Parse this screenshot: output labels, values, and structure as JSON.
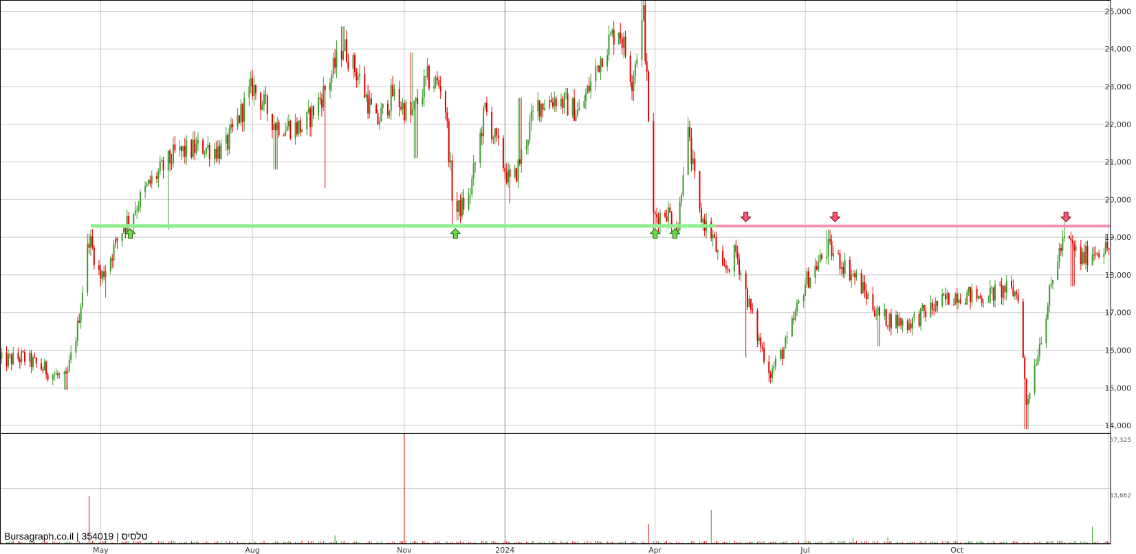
{
  "caption": "Bursagraph.co.il | 354019 | טלסיס",
  "colors": {
    "up": "#3a9a2a",
    "down": "#e00000",
    "support_line": "#90ee90",
    "resistance_line": "#f48fb1",
    "grid": "#c8c8c8",
    "up_marker": "#66dd44",
    "down_marker": "#ff5577"
  },
  "icons": {
    "up_marker": "arrow-up-icon",
    "down_marker": "arrow-down-icon"
  },
  "chart_data": {
    "type": "candlestick",
    "title": "",
    "xlabel": "",
    "ylabel": "",
    "x_range": [
      "2023-03-01",
      "2025-01-02"
    ],
    "ylim": [
      13800,
      25300
    ],
    "y_ticks": [
      14000,
      15000,
      16000,
      17000,
      18000,
      19000,
      20000,
      21000,
      22000,
      23000,
      24000,
      25000
    ],
    "y_tick_labels": [
      "14,000",
      "15,000",
      "16,000",
      "17,000",
      "18,000",
      "19,000",
      "20,000",
      "21,000",
      "22,000",
      "23,000",
      "24,000",
      "25,000"
    ],
    "x_ticks": [
      {
        "date": "2023-05-01",
        "label": "May"
      },
      {
        "date": "2023-08-01",
        "label": "Aug"
      },
      {
        "date": "2023-11-01",
        "label": "Nov"
      },
      {
        "date": "2024-01-01",
        "label": "2024"
      },
      {
        "date": "2024-04-01",
        "label": "Apr"
      },
      {
        "date": "2024-07-01",
        "label": "Jul"
      },
      {
        "date": "2024-10-01",
        "label": "Oct"
      },
      {
        "date": "2025-01-01",
        "label": ""
      }
    ],
    "grid": true,
    "price_path": [
      [
        "2023-03-01",
        15700
      ],
      [
        "2023-03-15",
        15800
      ],
      [
        "2023-04-01",
        15400
      ],
      [
        "2023-04-10",
        15200
      ],
      [
        "2023-04-17",
        16600
      ],
      [
        "2023-04-24",
        19000
      ],
      [
        "2023-05-01",
        17900
      ],
      [
        "2023-05-08",
        18600
      ],
      [
        "2023-05-15",
        19300
      ],
      [
        "2023-05-22",
        19800
      ],
      [
        "2023-06-01",
        20500
      ],
      [
        "2023-06-15",
        21200
      ],
      [
        "2023-07-01",
        21400
      ],
      [
        "2023-07-15",
        21300
      ],
      [
        "2023-08-01",
        23000
      ],
      [
        "2023-08-15",
        22000
      ],
      [
        "2023-09-01",
        21900
      ],
      [
        "2023-09-15",
        23000
      ],
      [
        "2023-09-25",
        24100
      ],
      [
        "2023-10-05",
        23200
      ],
      [
        "2023-10-15",
        22000
      ],
      [
        "2023-10-25",
        22800
      ],
      [
        "2023-11-05",
        22200
      ],
      [
        "2023-11-15",
        23200
      ],
      [
        "2023-11-25",
        23000
      ],
      [
        "2023-12-01",
        19600
      ],
      [
        "2023-12-10",
        20000
      ],
      [
        "2023-12-20",
        22400
      ],
      [
        "2024-01-05",
        20300
      ],
      [
        "2024-01-20",
        22500
      ],
      [
        "2024-02-01",
        22700
      ],
      [
        "2024-02-15",
        22300
      ],
      [
        "2024-03-01",
        24000
      ],
      [
        "2024-03-10",
        24600
      ],
      [
        "2024-03-18",
        23200
      ],
      [
        "2024-03-25",
        24900
      ],
      [
        "2024-03-31",
        19500
      ],
      [
        "2024-04-08",
        19700
      ],
      [
        "2024-04-15",
        19300
      ],
      [
        "2024-04-20",
        22000
      ],
      [
        "2024-04-28",
        19600
      ],
      [
        "2024-05-06",
        19000
      ],
      [
        "2024-05-12",
        18000
      ],
      [
        "2024-05-20",
        18600
      ],
      [
        "2024-06-01",
        16500
      ],
      [
        "2024-06-10",
        15400
      ],
      [
        "2024-06-20",
        16200
      ],
      [
        "2024-07-01",
        17800
      ],
      [
        "2024-07-15",
        18700
      ],
      [
        "2024-08-01",
        17900
      ],
      [
        "2024-08-15",
        16900
      ],
      [
        "2024-09-01",
        16700
      ],
      [
        "2024-09-15",
        17100
      ],
      [
        "2024-10-01",
        17500
      ],
      [
        "2024-10-15",
        17400
      ],
      [
        "2024-10-30",
        17600
      ],
      [
        "2024-11-07",
        17500
      ],
      [
        "2024-11-12",
        14600
      ],
      [
        "2024-11-20",
        16200
      ],
      [
        "2024-12-01",
        18500
      ],
      [
        "2024-12-06",
        19000
      ],
      [
        "2024-12-15",
        18400
      ],
      [
        "2024-12-25",
        18700
      ],
      [
        "2025-01-01",
        18700
      ]
    ],
    "lows": [
      [
        "2023-04-10",
        14950
      ],
      [
        "2023-05-05",
        17400
      ],
      [
        "2023-06-10",
        19200
      ],
      [
        "2023-08-15",
        20800
      ],
      [
        "2023-09-15",
        20300
      ],
      [
        "2023-11-08",
        21100
      ],
      [
        "2023-12-01",
        19350
      ],
      [
        "2024-01-05",
        19900
      ],
      [
        "2024-03-31",
        19000
      ],
      [
        "2024-04-12",
        19100
      ],
      [
        "2024-05-25",
        15800
      ],
      [
        "2024-06-10",
        15150
      ],
      [
        "2024-08-15",
        16100
      ],
      [
        "2024-11-12",
        13900
      ],
      [
        "2024-12-10",
        17700
      ]
    ],
    "highs": [
      [
        "2023-04-24",
        19100
      ],
      [
        "2023-08-01",
        23300
      ],
      [
        "2023-09-25",
        24600
      ],
      [
        "2023-11-05",
        23900
      ],
      [
        "2024-01-10",
        22700
      ],
      [
        "2024-03-25",
        25300
      ],
      [
        "2024-04-20",
        22200
      ],
      [
        "2024-07-15",
        19200
      ],
      [
        "2024-12-06",
        19400
      ]
    ],
    "support": {
      "value": 19300,
      "from": "2023-04-25",
      "to": "2024-05-08"
    },
    "resistance": {
      "value": 19300,
      "from": "2024-05-08",
      "to": "2025-01-02"
    },
    "up_markers": [
      "2023-05-19",
      "2023-12-02",
      "2024-04-01",
      "2024-04-13"
    ],
    "down_markers": [
      "2024-05-26",
      "2024-07-19",
      "2024-12-06"
    ],
    "volume": {
      "ylim": [
        0,
        67325
      ],
      "y_ticks": [
        33662,
        67325
      ],
      "y_tick_labels": [
        "33,662",
        "67,325"
      ],
      "spikes": [
        [
          "2023-04-24",
          29000
        ],
        [
          "2023-09-20",
          5000
        ],
        [
          "2023-11-01",
          67325
        ],
        [
          "2023-12-01",
          9500
        ],
        [
          "2024-03-28",
          12000
        ],
        [
          "2024-05-05",
          20500
        ],
        [
          "2024-07-30",
          3500
        ],
        [
          "2024-08-20",
          4000
        ],
        [
          "2024-11-15",
          11000
        ],
        [
          "2024-12-22",
          10500
        ]
      ]
    }
  }
}
